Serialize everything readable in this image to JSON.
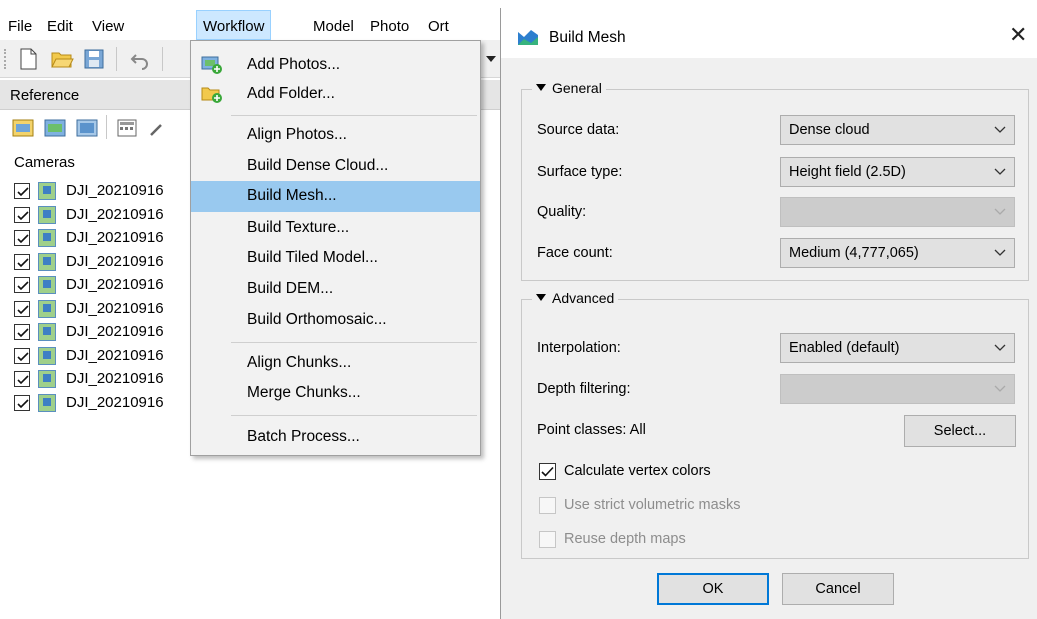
{
  "menubar": {
    "items": [
      "File",
      "Edit",
      "View",
      "Workflow",
      "Model",
      "Photo",
      "Ort"
    ],
    "active": "Workflow"
  },
  "toolbar": {
    "icons": [
      "new-document-icon",
      "open-folder-icon",
      "save-icon",
      "undo-icon"
    ]
  },
  "reference_panel": {
    "title": "Reference",
    "cameras_label": "Cameras",
    "cameras": [
      "DJI_20210916",
      "DJI_20210916",
      "DJI_20210916",
      "DJI_20210916",
      "DJI_20210916",
      "DJI_20210916",
      "DJI_20210916",
      "DJI_20210916",
      "DJI_20210916",
      "DJI_20210916"
    ]
  },
  "workflow_menu": {
    "items": [
      {
        "label": "Add Photos...",
        "icon": "add-photos-icon"
      },
      {
        "label": "Add Folder...",
        "icon": "add-folder-icon"
      },
      {
        "label": "Align Photos..."
      },
      {
        "label": "Build Dense Cloud..."
      },
      {
        "label": "Build Mesh...",
        "highlighted": true
      },
      {
        "label": "Build Texture..."
      },
      {
        "label": "Build Tiled Model..."
      },
      {
        "label": "Build DEM..."
      },
      {
        "label": "Build Orthomosaic..."
      },
      {
        "label": "Align Chunks..."
      },
      {
        "label": "Merge Chunks..."
      },
      {
        "label": "Batch Process..."
      }
    ]
  },
  "dialog": {
    "title": "Build Mesh",
    "close_glyph": "✕",
    "general": {
      "legend": "General",
      "source_data_label": "Source data:",
      "source_data_value": "Dense cloud",
      "surface_type_label": "Surface type:",
      "surface_type_value": "Height field (2.5D)",
      "quality_label": "Quality:",
      "quality_value": "",
      "face_count_label": "Face count:",
      "face_count_value": "Medium (4,777,065)"
    },
    "advanced": {
      "legend": "Advanced",
      "interpolation_label": "Interpolation:",
      "interpolation_value": "Enabled (default)",
      "depth_filtering_label": "Depth filtering:",
      "depth_filtering_value": "",
      "point_classes_label": "Point classes:  All",
      "select_button": "Select...",
      "calc_vertex_colors": {
        "label": "Calculate vertex colors",
        "checked": true
      },
      "strict_masks": {
        "label": "Use strict volumetric masks",
        "checked": false,
        "disabled": true
      },
      "reuse_depth": {
        "label": "Reuse depth maps",
        "checked": false,
        "disabled": true
      }
    },
    "ok_label": "OK",
    "cancel_label": "Cancel"
  },
  "colors": {
    "menu_highlight": "#99c9ef",
    "active_menu": "#cde8ff",
    "focus_border": "#0078d7"
  }
}
